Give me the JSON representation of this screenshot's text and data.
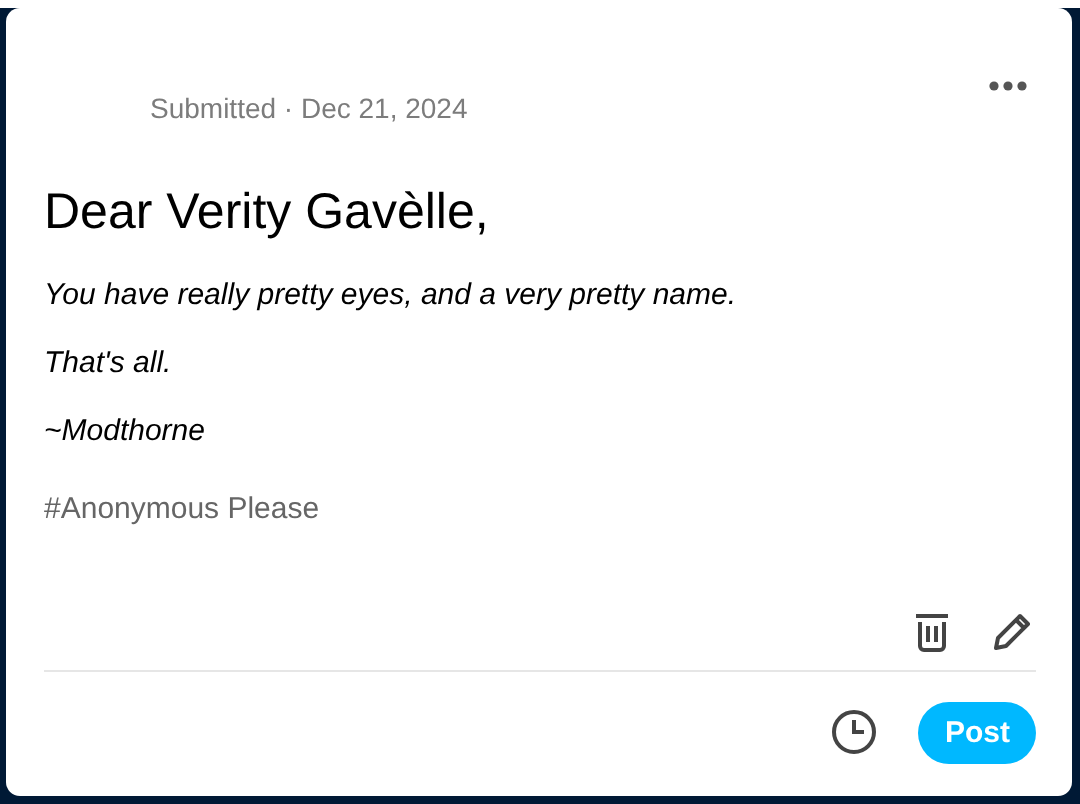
{
  "post": {
    "meta": "Submitted · Dec 21, 2024",
    "title": "Dear Verity Gavèlle,",
    "paragraphs": [
      "You have really pretty eyes, and a very pretty name.",
      "That's all.",
      "~Modthorne"
    ],
    "tags": [
      "#Anonymous Please"
    ]
  },
  "footer": {
    "post_button": "Post"
  }
}
